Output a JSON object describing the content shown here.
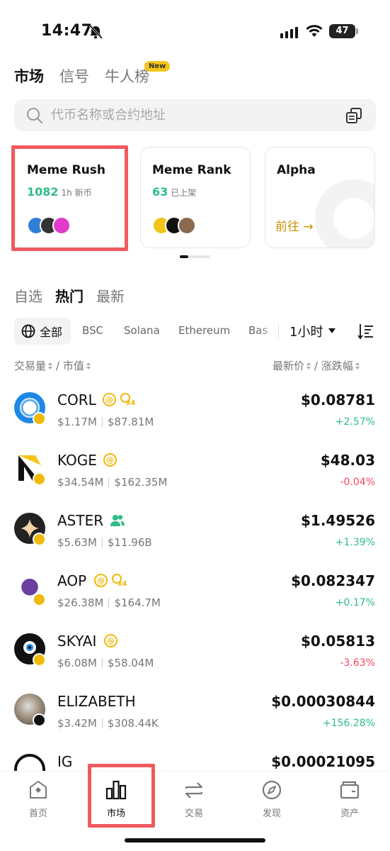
{
  "status_bar": {
    "time": "14:47",
    "battery": "47"
  },
  "top_tabs": [
    {
      "label": "市场",
      "active": true
    },
    {
      "label": "信号",
      "active": false
    },
    {
      "label": "牛人榜",
      "active": false
    }
  ],
  "new_badge": "New",
  "search": {
    "placeholder": "代币名称或合约地址"
  },
  "cards": [
    {
      "title": "Meme Rush",
      "count": "1082",
      "unit": "1h 新币"
    },
    {
      "title": "Meme Rank",
      "count": "63",
      "unit": "已上架"
    },
    {
      "title": "Alpha",
      "link": "前往 →"
    }
  ],
  "list_tabs": [
    {
      "label": "自选",
      "active": false
    },
    {
      "label": "热门",
      "active": true
    },
    {
      "label": "最新",
      "active": false
    }
  ],
  "chains": [
    "全部",
    "BSC",
    "Solana",
    "Ethereum",
    "Bas"
  ],
  "timeframe": "1小时",
  "columns": {
    "left_a": "交易量",
    "left_b": "/ 市值",
    "right_a": "最新价",
    "right_b": "/ 涨跌幅"
  },
  "tokens": [
    {
      "symbol": "CORL",
      "volume": "$1.17M",
      "mcap": "$87.81M",
      "price": "$0.08781",
      "change": "+2.57%",
      "up": true
    },
    {
      "symbol": "KOGE",
      "volume": "$34.54M",
      "mcap": "$162.35M",
      "price": "$48.03",
      "change": "-0.04%",
      "up": false
    },
    {
      "symbol": "ASTER",
      "volume": "$5.63M",
      "mcap": "$11.96B",
      "price": "$1.49526",
      "change": "+1.39%",
      "up": true
    },
    {
      "symbol": "AOP",
      "volume": "$26.38M",
      "mcap": "$164.7M",
      "price": "$0.082347",
      "change": "+0.17%",
      "up": true
    },
    {
      "symbol": "SKYAI",
      "volume": "$6.08M",
      "mcap": "$58.04M",
      "price": "$0.05813",
      "change": "-3.63%",
      "up": false
    },
    {
      "symbol": "ELIZABETH",
      "volume": "$3.42M",
      "mcap": "$308.44K",
      "price": "$0.00030844",
      "change": "+156.28%",
      "up": true
    },
    {
      "symbol": "IG",
      "price": "$0.00021095"
    }
  ],
  "tag_labels": {
    "at": "@",
    "vx": "x4"
  },
  "bottom_nav": [
    {
      "label": "首页",
      "icon": "home-icon"
    },
    {
      "label": "市场",
      "icon": "market-bar-chart-icon"
    },
    {
      "label": "交易",
      "icon": "trade-swap-icon"
    },
    {
      "label": "发现",
      "icon": "compass-icon"
    },
    {
      "label": "资产",
      "icon": "wallet-icon"
    }
  ],
  "colors": {
    "up": "#2ebd85",
    "down": "#f6465d",
    "brand": "#f0b90b",
    "highlight": "#ef5a5f"
  }
}
